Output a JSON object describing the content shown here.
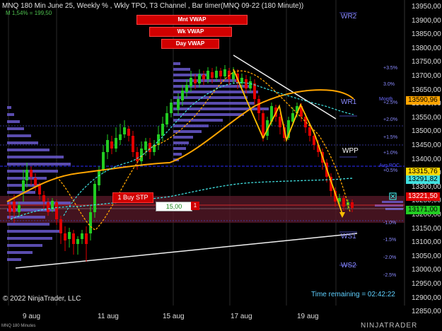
{
  "header": {
    "title": "MNQ 180 Min June 25, Weekly % , Wkly TPO, T3 Channel , Bar timer(MNQ 09-22 (180 Minute))",
    "subtitle": "M 1,54% = 199,50"
  },
  "vwap_buttons": {
    "monthly": "Mnt VWAP",
    "weekly": "Wk VWAP",
    "daily": "Day VWAP"
  },
  "price_axis": {
    "labels": [
      "13950,00",
      "13900,00",
      "13850,00",
      "13800,00",
      "13750,00",
      "13700,00",
      "13650,00",
      "13600,00",
      "13550,00",
      "13500,00",
      "13450,00",
      "13400,00",
      "13350,00",
      "13300,00",
      "13250,00",
      "13200,00",
      "13150,00",
      "13100,00",
      "13050,00",
      "13000,00",
      "12950,00",
      "12900,00",
      "12850,00"
    ],
    "highlights": [
      {
        "value": "13590,96",
        "color": "#ffa500"
      },
      {
        "value": "13315,76",
        "color": "#ffd700"
      },
      {
        "value": "13291,82",
        "color": "#40e0e0"
      },
      {
        "value": "13221,50",
        "color": "#e00000"
      },
      {
        "value": "13171,00",
        "color": "#22cc22"
      }
    ]
  },
  "date_axis": [
    "9 aug",
    "11 aug",
    "15 aug",
    "17 aug",
    "19 aug"
  ],
  "pct_labels": [
    "+3.5%",
    "3.0%",
    "+2.5%",
    "+2.0%",
    "+1.5%",
    "+1.0%",
    "+0.5%",
    "-1.0%",
    "-1.5%",
    "-2.0%",
    "-2.5%"
  ],
  "level_labels": {
    "wr2": "WR2",
    "wr1": "WR1",
    "wpp": "WPP",
    "ws1": "WS1",
    "ws2": "WS2",
    "month": "Month",
    "avg": "Avg POC"
  },
  "order": {
    "label": "1 Buy STP",
    "qty": "15,00",
    "qty_count": "1"
  },
  "footer": {
    "copyright": "© 2022 NinjaTrader, LLC",
    "timer": "Time remaining = 02:42:22",
    "chart_tag": "MNQ 180 Minutes",
    "logo": "NINJATRADER"
  },
  "colors": {
    "up": "#22cc22",
    "down": "#e00000",
    "profile": "#6a5acd",
    "vwap": "#ffa500",
    "band": "#40e0e0"
  }
}
